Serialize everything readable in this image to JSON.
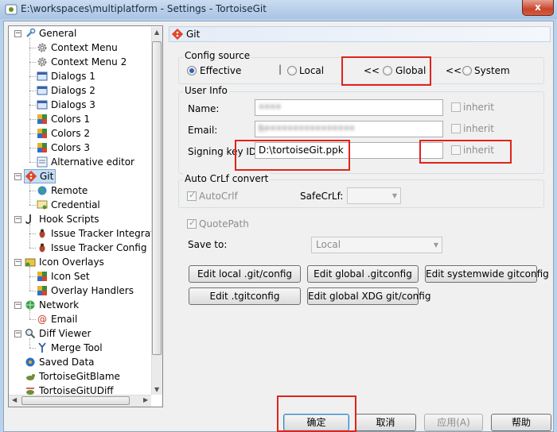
{
  "window": {
    "title": "E:\\workspaces\\multiplatform - Settings - TortoiseGit",
    "close_glyph": "x"
  },
  "tree": {
    "items": [
      {
        "label": "General",
        "icon": "wrench-icon"
      },
      {
        "label": "Context Menu",
        "icon": "gear-icon"
      },
      {
        "label": "Context Menu 2",
        "icon": "gear-icon"
      },
      {
        "label": "Dialogs 1",
        "icon": "dialog-icon"
      },
      {
        "label": "Dialogs 2",
        "icon": "dialog-icon"
      },
      {
        "label": "Dialogs 3",
        "icon": "dialog-icon"
      },
      {
        "label": "Colors 1",
        "icon": "palette-icon"
      },
      {
        "label": "Colors 2",
        "icon": "palette-icon"
      },
      {
        "label": "Colors 3",
        "icon": "palette-icon"
      },
      {
        "label": "Alternative editor",
        "icon": "editor-icon"
      },
      {
        "label": "Git",
        "icon": "git-icon"
      },
      {
        "label": "Remote",
        "icon": "globe-icon"
      },
      {
        "label": "Credential",
        "icon": "certificate-icon"
      },
      {
        "label": "Hook Scripts",
        "icon": "hook-icon"
      },
      {
        "label": "Issue Tracker Integrati",
        "icon": "bug-icon"
      },
      {
        "label": "Issue Tracker Config",
        "icon": "bug-icon"
      },
      {
        "label": "Icon Overlays",
        "icon": "overlay-icon"
      },
      {
        "label": "Icon Set",
        "icon": "palette-icon"
      },
      {
        "label": "Overlay Handlers",
        "icon": "palette-icon"
      },
      {
        "label": "Network",
        "icon": "network-icon"
      },
      {
        "label": "Email",
        "icon": "at-icon"
      },
      {
        "label": "Diff Viewer",
        "icon": "magnifier-icon"
      },
      {
        "label": "Merge Tool",
        "icon": "merge-icon"
      },
      {
        "label": "Saved Data",
        "icon": "saved-data-icon"
      },
      {
        "label": "TortoiseGitBlame",
        "icon": "blame-icon"
      },
      {
        "label": "TortoiseGitUDiff",
        "icon": "udiff-icon"
      }
    ],
    "selected": "Git"
  },
  "panel": {
    "title": "Git",
    "config_source": {
      "label": "Config source",
      "effective": "Effective",
      "local": "Local",
      "global": "Global",
      "system": "System",
      "sep1": "|",
      "arrows1": "<<",
      "arrows2": "<<",
      "selected": "Effective"
    },
    "user_info": {
      "label": "User Info",
      "name_label": "Name:",
      "name_value": "••••",
      "email_label": "Email:",
      "email_value": "h••••••••••••••••",
      "signing_label": "Signing key ID:",
      "signing_value": "D:\\tortoiseGit.ppk",
      "inherit": "inherit"
    },
    "autocrlf": {
      "label": "Auto CrLf convert",
      "autocrlf_label": "AutoCrlf",
      "safecrlf_label": "SafeCrLf:",
      "safecrlf_value": ""
    },
    "quotepath": "QuotePath",
    "save_to": {
      "label": "Save to:",
      "value": "Local"
    },
    "buttons": {
      "edit_local": "Edit local .git/config",
      "edit_global": "Edit global .gitconfig",
      "edit_system": "Edit systemwide gitconfig",
      "edit_tgit": "Edit .tgitconfig",
      "edit_xdg": "Edit global XDG git/config"
    }
  },
  "footer": {
    "ok": "确定",
    "cancel": "取消",
    "apply": "应用(A)",
    "help": "帮助"
  },
  "colors": {
    "highlight_box": "#e0231c",
    "selection": "#c5ddf5"
  }
}
